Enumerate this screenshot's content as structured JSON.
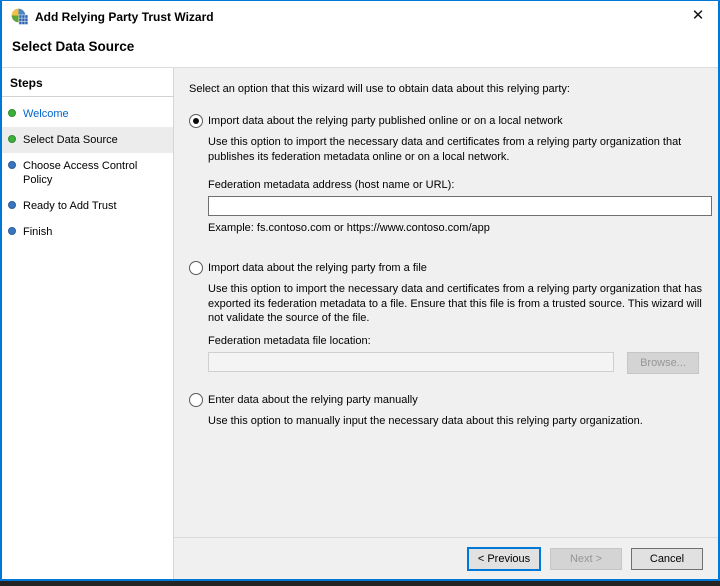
{
  "window": {
    "title": "Add Relying Party Trust Wizard",
    "close_glyph": "✕"
  },
  "page": {
    "title": "Select Data Source"
  },
  "sidebar": {
    "title": "Steps",
    "items": [
      {
        "label": "Welcome",
        "state": "done"
      },
      {
        "label": "Select Data Source",
        "state": "current"
      },
      {
        "label": "Choose Access Control Policy",
        "state": "todo"
      },
      {
        "label": "Ready to Add Trust",
        "state": "todo"
      },
      {
        "label": "Finish",
        "state": "todo"
      }
    ]
  },
  "content": {
    "intro": "Select an option that this wizard will use to obtain data about this relying party:",
    "option_online": {
      "label": "Import data about the relying party published online or on a local network",
      "description": "Use this option to import the necessary data and certificates from a relying party organization that publishes its federation metadata online or on a local network.",
      "field_label": "Federation metadata address (host name or URL):",
      "field_value": "",
      "example": "Example: fs.contoso.com or https://www.contoso.com/app"
    },
    "option_file": {
      "label": "Import data about the relying party from a file",
      "description": "Use this option to import the necessary data and certificates from a relying party organization that has exported its federation metadata to a file. Ensure that this file is from a trusted source.  This wizard will not validate the source of the file.",
      "field_label": "Federation metadata file location:",
      "field_value": "",
      "browse_label": "Browse..."
    },
    "option_manual": {
      "label": "Enter data about the relying party manually",
      "description": "Use this option to manually input the necessary data about this relying party organization."
    }
  },
  "footer": {
    "previous_label": "< Previous",
    "next_label": "Next >",
    "cancel_label": "Cancel"
  },
  "colors": {
    "accent": "#0078d7",
    "link": "#0066cc",
    "step_done": "#3cb03c",
    "step_todo": "#3a76c0",
    "content_bg": "#f0f0f0"
  }
}
